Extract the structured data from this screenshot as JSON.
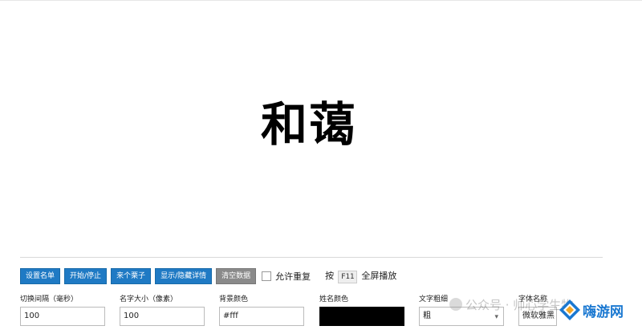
{
  "display": {
    "name": "和蔼"
  },
  "toolbar": {
    "buttons": [
      "设置名单",
      "开始/停止",
      "来个栗子",
      "显示/隐藏详情",
      "清空数据"
    ],
    "allow_repeat_label": "允许重复",
    "hint_prefix": "按",
    "hint_key": "F11",
    "hint_suffix": "全屏播放"
  },
  "settings": {
    "interval": {
      "label": "切换间隔（毫秒）",
      "value": "100"
    },
    "font_size": {
      "label": "名字大小（像素）",
      "value": "100"
    },
    "bg_color": {
      "label": "背景颜色",
      "value": "#fff"
    },
    "name_color": {
      "label": "姓名颜色",
      "value": ""
    },
    "font_weight": {
      "label": "文字粗细",
      "value": "粗"
    },
    "font_family": {
      "label": "字体名称",
      "value": "微软雅黑"
    }
  },
  "overlay": {
    "watermark_text": "公众号 · 帅心学生物",
    "logo_text": "嗨游网"
  },
  "colors": {
    "button": "#1f7ac4",
    "button_gray": "#8a8a8a",
    "name_color_swatch": "#000000",
    "logo": "#1a78d1"
  }
}
